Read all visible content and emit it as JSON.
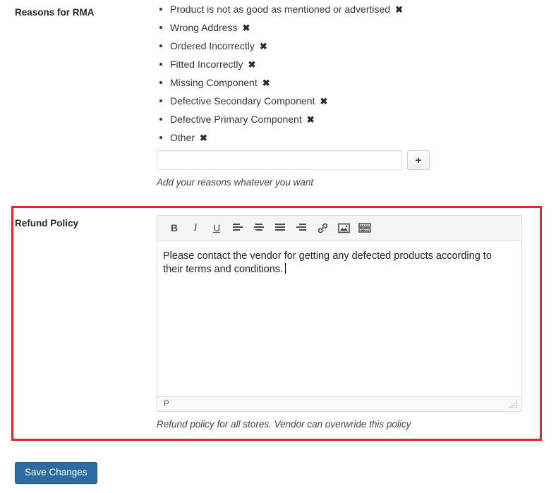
{
  "reasons_section": {
    "label": "Reasons for RMA",
    "items": [
      {
        "label": "Product is not as good as mentioned or advertised",
        "remove": "✖"
      },
      {
        "label": "Wrong Address",
        "remove": "✖"
      },
      {
        "label": "Ordered Incorrectly",
        "remove": "✖"
      },
      {
        "label": "Fitted Incorrectly",
        "remove": "✖"
      },
      {
        "label": "Missing Component",
        "remove": "✖"
      },
      {
        "label": "Defective Secondary Component",
        "remove": "✖"
      },
      {
        "label": "Defective Primary Component",
        "remove": "✖"
      },
      {
        "label": "Other",
        "remove": "✖"
      }
    ],
    "add_input_value": "",
    "add_input_placeholder": "",
    "add_button_label": "+",
    "helper_text": "Add your reasons whatever you want"
  },
  "refund_section": {
    "label": "Refund Policy",
    "highlight_color": "#e3262c",
    "toolbar": [
      {
        "name": "bold",
        "glyph": "B"
      },
      {
        "name": "italic",
        "glyph": "I"
      },
      {
        "name": "underline",
        "glyph": "U"
      },
      {
        "name": "align-left",
        "glyph": ""
      },
      {
        "name": "align-center",
        "glyph": ""
      },
      {
        "name": "justify",
        "glyph": ""
      },
      {
        "name": "align-right",
        "glyph": ""
      },
      {
        "name": "link",
        "glyph": ""
      },
      {
        "name": "image",
        "glyph": ""
      },
      {
        "name": "keyboard",
        "glyph": ""
      }
    ],
    "content": "Please contact the vendor for getting any defected products according to their terms and conditions.",
    "status_path": "P",
    "helper_text": "Refund policy for all stores. Vendor can overwride this policy"
  },
  "footer": {
    "save_label": "Save Changes",
    "save_color": "#2b6ca3"
  }
}
